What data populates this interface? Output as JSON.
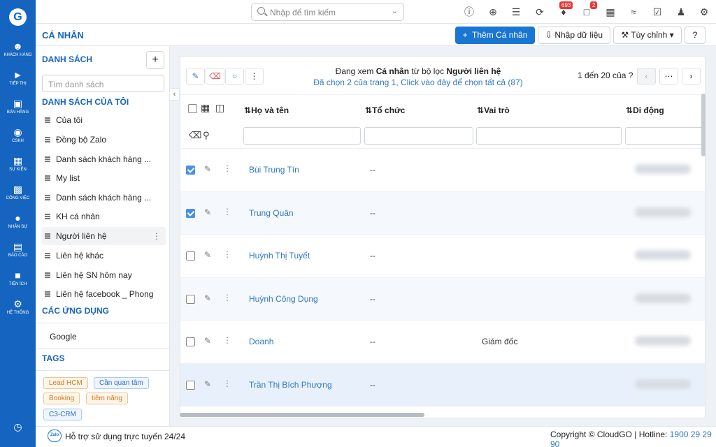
{
  "app": {
    "logo": "G",
    "brand_color": "#1565c0"
  },
  "nav": [
    {
      "label": "KHÁCH HÀNG",
      "icon": "users-icon"
    },
    {
      "label": "TIẾP THỊ",
      "icon": "megaphone-icon"
    },
    {
      "label": "BÁN HÀNG",
      "icon": "cart-icon"
    },
    {
      "label": "CSKH",
      "icon": "lifebuoy-icon"
    },
    {
      "label": "SỰ KIỆN",
      "icon": "calendar-icon"
    },
    {
      "label": "CÔNG VIỆC",
      "icon": "briefcase-icon"
    },
    {
      "label": "NHÂN SỰ",
      "icon": "person-icon"
    },
    {
      "label": "BÁO CÁO",
      "icon": "chart-icon"
    },
    {
      "label": "TIỆN ÍCH",
      "icon": "box-icon"
    },
    {
      "label": "HỆ THỐNG",
      "icon": "wrench-icon"
    }
  ],
  "search": {
    "placeholder": "Nhập để tìm kiếm"
  },
  "topbar_badges": {
    "notifications": "693",
    "messages": "2"
  },
  "page": {
    "title": "CÁ NHÂN"
  },
  "actions": {
    "add": "Thêm Cá nhân",
    "import": "Nhập dữ liệu",
    "customize": "Tùy chỉnh"
  },
  "sidebar": {
    "lists_heading": "DANH SÁCH",
    "search_placeholder": "Tìm danh sách",
    "my_lists_heading": "DANH SÁCH CỦA TÔI",
    "items": [
      "Của tôi",
      "Đồng bộ Zalo",
      "Danh sách khách hàng ...",
      "My list",
      "Danh sách khách hàng ...",
      "KH cá nhân",
      "Người liên hệ",
      "Liên hệ khác",
      "Liên hệ SN hôm nay",
      "Liên hệ facebook _ Phong"
    ],
    "apps_heading": "CÁC ỨNG DỤNG",
    "apps": [
      "Google"
    ],
    "tags_heading": "TAGS",
    "tags": [
      "Lead HCM",
      "Cần quan tâm",
      "Booking",
      "tiềm năng",
      "C3-CRM"
    ]
  },
  "view": {
    "line1_prefix": "Đang xem ",
    "line1_entity": "Cá nhân",
    "line1_mid": " từ bộ lọc ",
    "line1_filter": "Người liên hệ",
    "line2": "Đã chọn 2 của trang 1, Click vào đây để chọn tất cả (87)",
    "paging": "1 đến 20 của",
    "paging_suffix": "?"
  },
  "columns": [
    "Họ và tên",
    "Tổ chức",
    "Vai trò",
    "Di động"
  ],
  "rows": [
    {
      "name": "Bùi Trung Tín",
      "org": "--",
      "role": "",
      "checked": true
    },
    {
      "name": "Trung Quân",
      "org": "--",
      "role": "",
      "checked": true
    },
    {
      "name": "Huỳnh Thị Tuyết",
      "org": "--",
      "role": "",
      "checked": false
    },
    {
      "name": "Huỳnh Công Dụng",
      "org": "--",
      "role": "",
      "checked": false
    },
    {
      "name": "Doanh",
      "org": "--",
      "role": "Giám đốc",
      "checked": false
    },
    {
      "name": "Trần Thị Bích Phượng",
      "org": "--",
      "role": "",
      "checked": false
    }
  ],
  "footer": {
    "support": "Hỗ trợ sử dụng trực tuyến 24/24",
    "copyright": "Copyright © CloudGO",
    "hotline_label": "Hotline:",
    "hotline": "1900 29 29 90"
  }
}
